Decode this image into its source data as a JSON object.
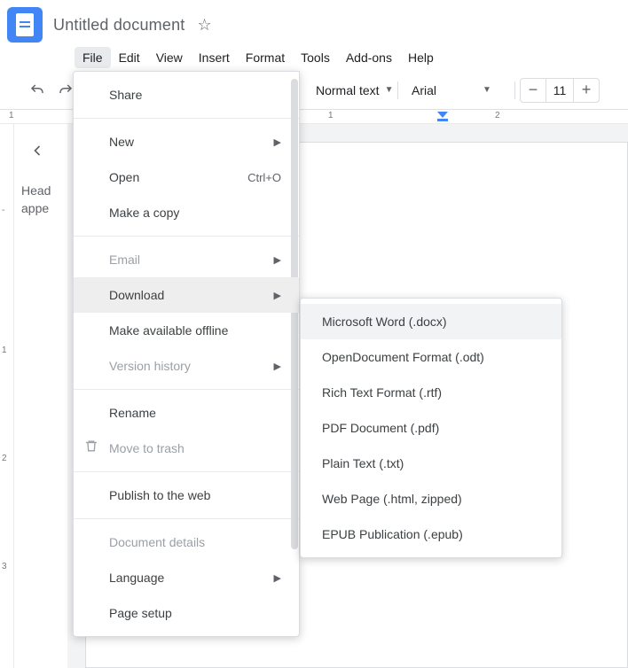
{
  "header": {
    "title": "Untitled document"
  },
  "menubar": [
    "File",
    "Edit",
    "View",
    "Insert",
    "Format",
    "Tools",
    "Add-ons",
    "Help"
  ],
  "toolbar": {
    "style_label": "Normal text",
    "font_label": "Arial",
    "font_size": "11"
  },
  "outline": {
    "text_line1": "Head",
    "text_line2": "appe"
  },
  "file_menu": {
    "share": "Share",
    "new": "New",
    "open": "Open",
    "open_shortcut": "Ctrl+O",
    "make_copy": "Make a copy",
    "email": "Email",
    "download": "Download",
    "make_offline": "Make available offline",
    "version_history": "Version history",
    "rename": "Rename",
    "move_trash": "Move to trash",
    "publish": "Publish to the web",
    "doc_details": "Document details",
    "language": "Language",
    "page_setup": "Page setup"
  },
  "download_submenu": [
    "Microsoft Word (.docx)",
    "OpenDocument Format (.odt)",
    "Rich Text Format (.rtf)",
    "PDF Document (.pdf)",
    "Plain Text (.txt)",
    "Web Page (.html, zipped)",
    "EPUB Publication (.epub)"
  ],
  "ruler": {
    "labels": [
      "1",
      "1",
      "2",
      "3"
    ]
  }
}
